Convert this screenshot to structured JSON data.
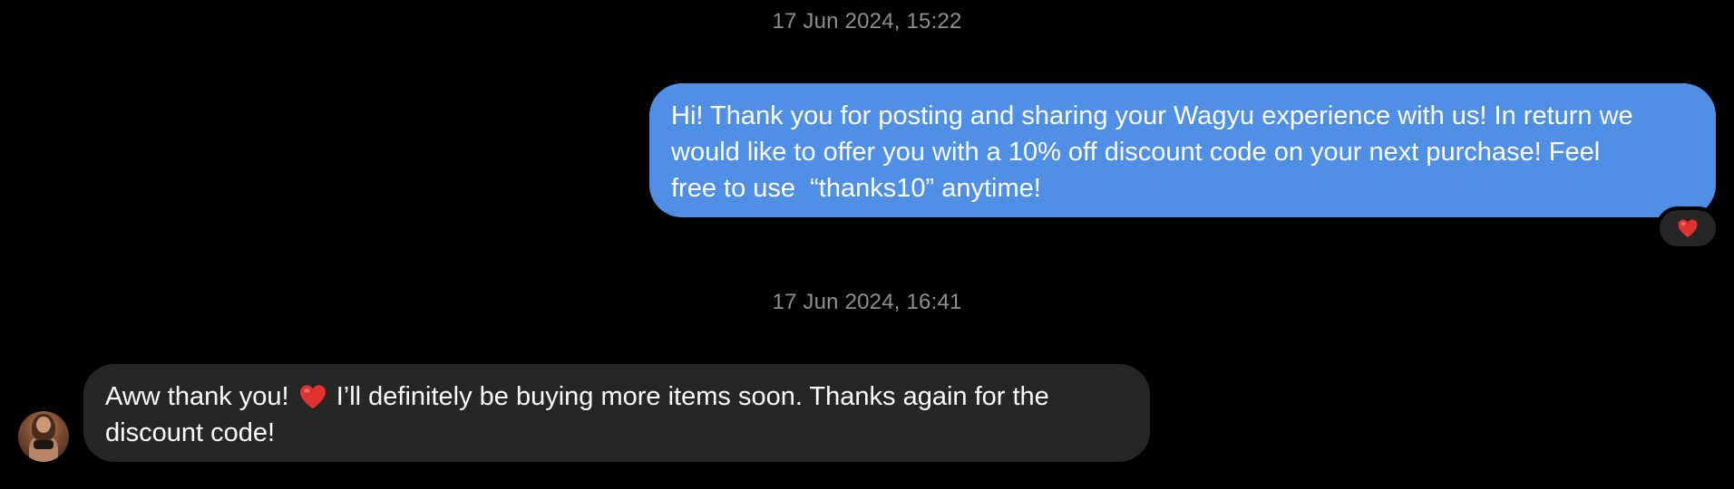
{
  "conversation": {
    "timestamps": [
      "17 Jun 2024, 15:22",
      "17 Jun 2024, 16:41"
    ],
    "sent_message": {
      "text": "Hi! Thank you for posting and sharing your Wagyu experience with us! In return we\nwould like to offer you with a 10% off discount code on your next purchase! Feel\nfree to use  “thanks10” anytime!",
      "reaction": "heart-icon",
      "bubble_color": "#4f8fe6"
    },
    "received_message": {
      "text_before_emoji": "Aww thank you! ",
      "emoji": "heart-icon",
      "text_after_emoji": " I’ll definitely be buying more items soon. Thanks again for the discount code!",
      "bubble_color": "#262626",
      "sender_avatar": "avatar"
    }
  },
  "colors": {
    "background": "#000000",
    "timestamp": "#8e8e93",
    "heart": "#e0322f"
  }
}
